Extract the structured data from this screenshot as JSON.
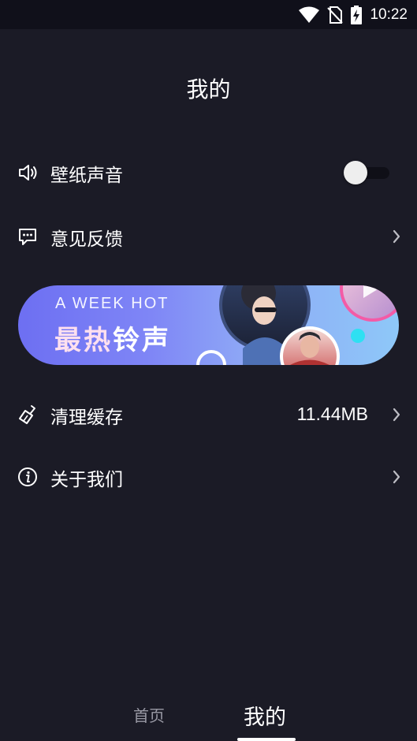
{
  "status_bar": {
    "time": "10:22",
    "icons": [
      "wifi-icon",
      "no-sim-icon",
      "battery-charging-icon"
    ]
  },
  "page": {
    "title": "我的"
  },
  "settings": {
    "wallpaper_sound": {
      "label": "壁纸声音",
      "icon": "speaker-icon",
      "toggle_on": false
    },
    "feedback": {
      "label": "意见反馈",
      "icon": "chat-bubble-icon"
    },
    "clear_cache": {
      "label": "清理缓存",
      "icon": "broom-icon",
      "value": "11.44MB"
    },
    "about": {
      "label": "关于我们",
      "icon": "info-icon"
    }
  },
  "banner": {
    "subtitle": "A WEEK HOT",
    "title_part1": "最热",
    "title_part2": "铃声",
    "colors": {
      "start": "#6d6ff2",
      "end": "#8ec8f8"
    }
  },
  "bottom_nav": {
    "tabs": [
      {
        "label": "首页",
        "active": false
      },
      {
        "label": "我的",
        "active": true
      }
    ]
  },
  "colors": {
    "background": "#1b1b26",
    "status_bar": "#10101a",
    "text": "#ffffff",
    "inactive_tab": "#9a9aa5"
  }
}
